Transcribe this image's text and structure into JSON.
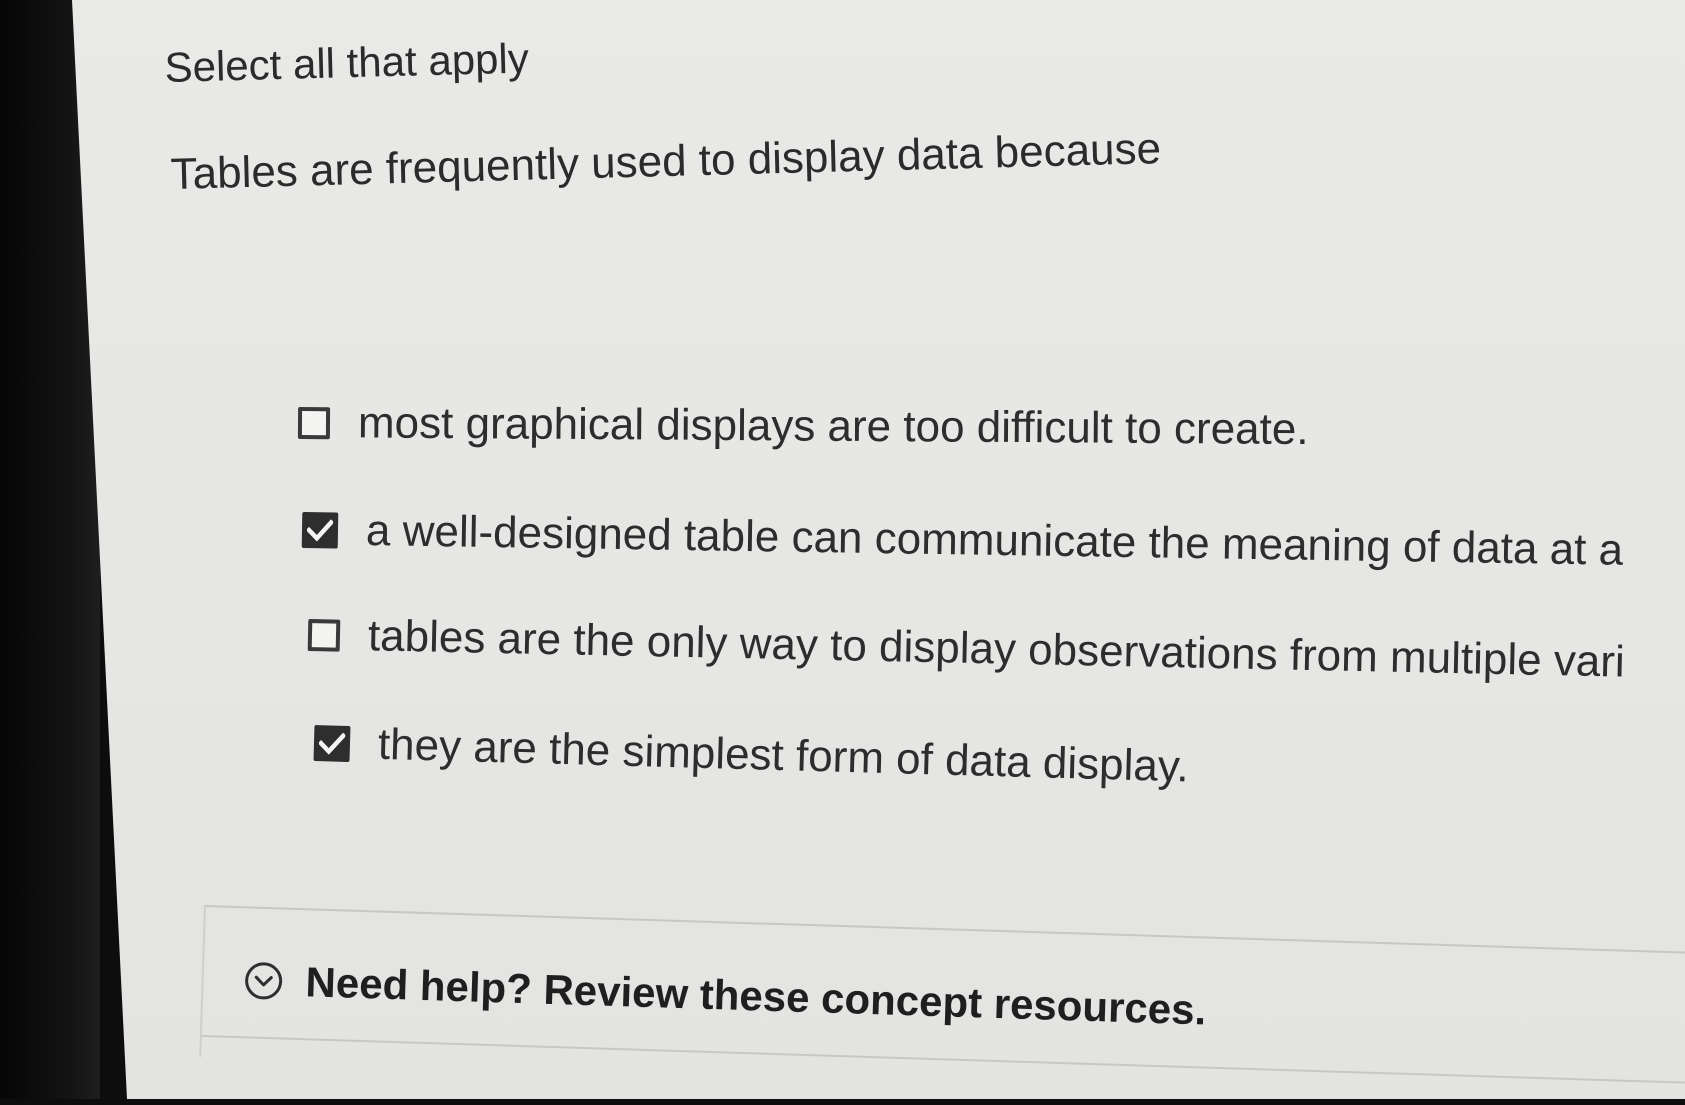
{
  "question": {
    "instruction": "Select all that apply",
    "prompt": "Tables are frequently used to display data because"
  },
  "options": [
    {
      "label": "most graphical displays are too difficult to create.",
      "checked": false
    },
    {
      "label": "a well-designed table can communicate the meaning of data at a",
      "checked": true
    },
    {
      "label": "tables are the only way to display observations from multiple vari",
      "checked": false
    },
    {
      "label": "they are the simplest form of data display.",
      "checked": true
    }
  ],
  "help": {
    "label": "Need help? Review these concept resources.",
    "icon": "chevron-down-circle-icon"
  }
}
